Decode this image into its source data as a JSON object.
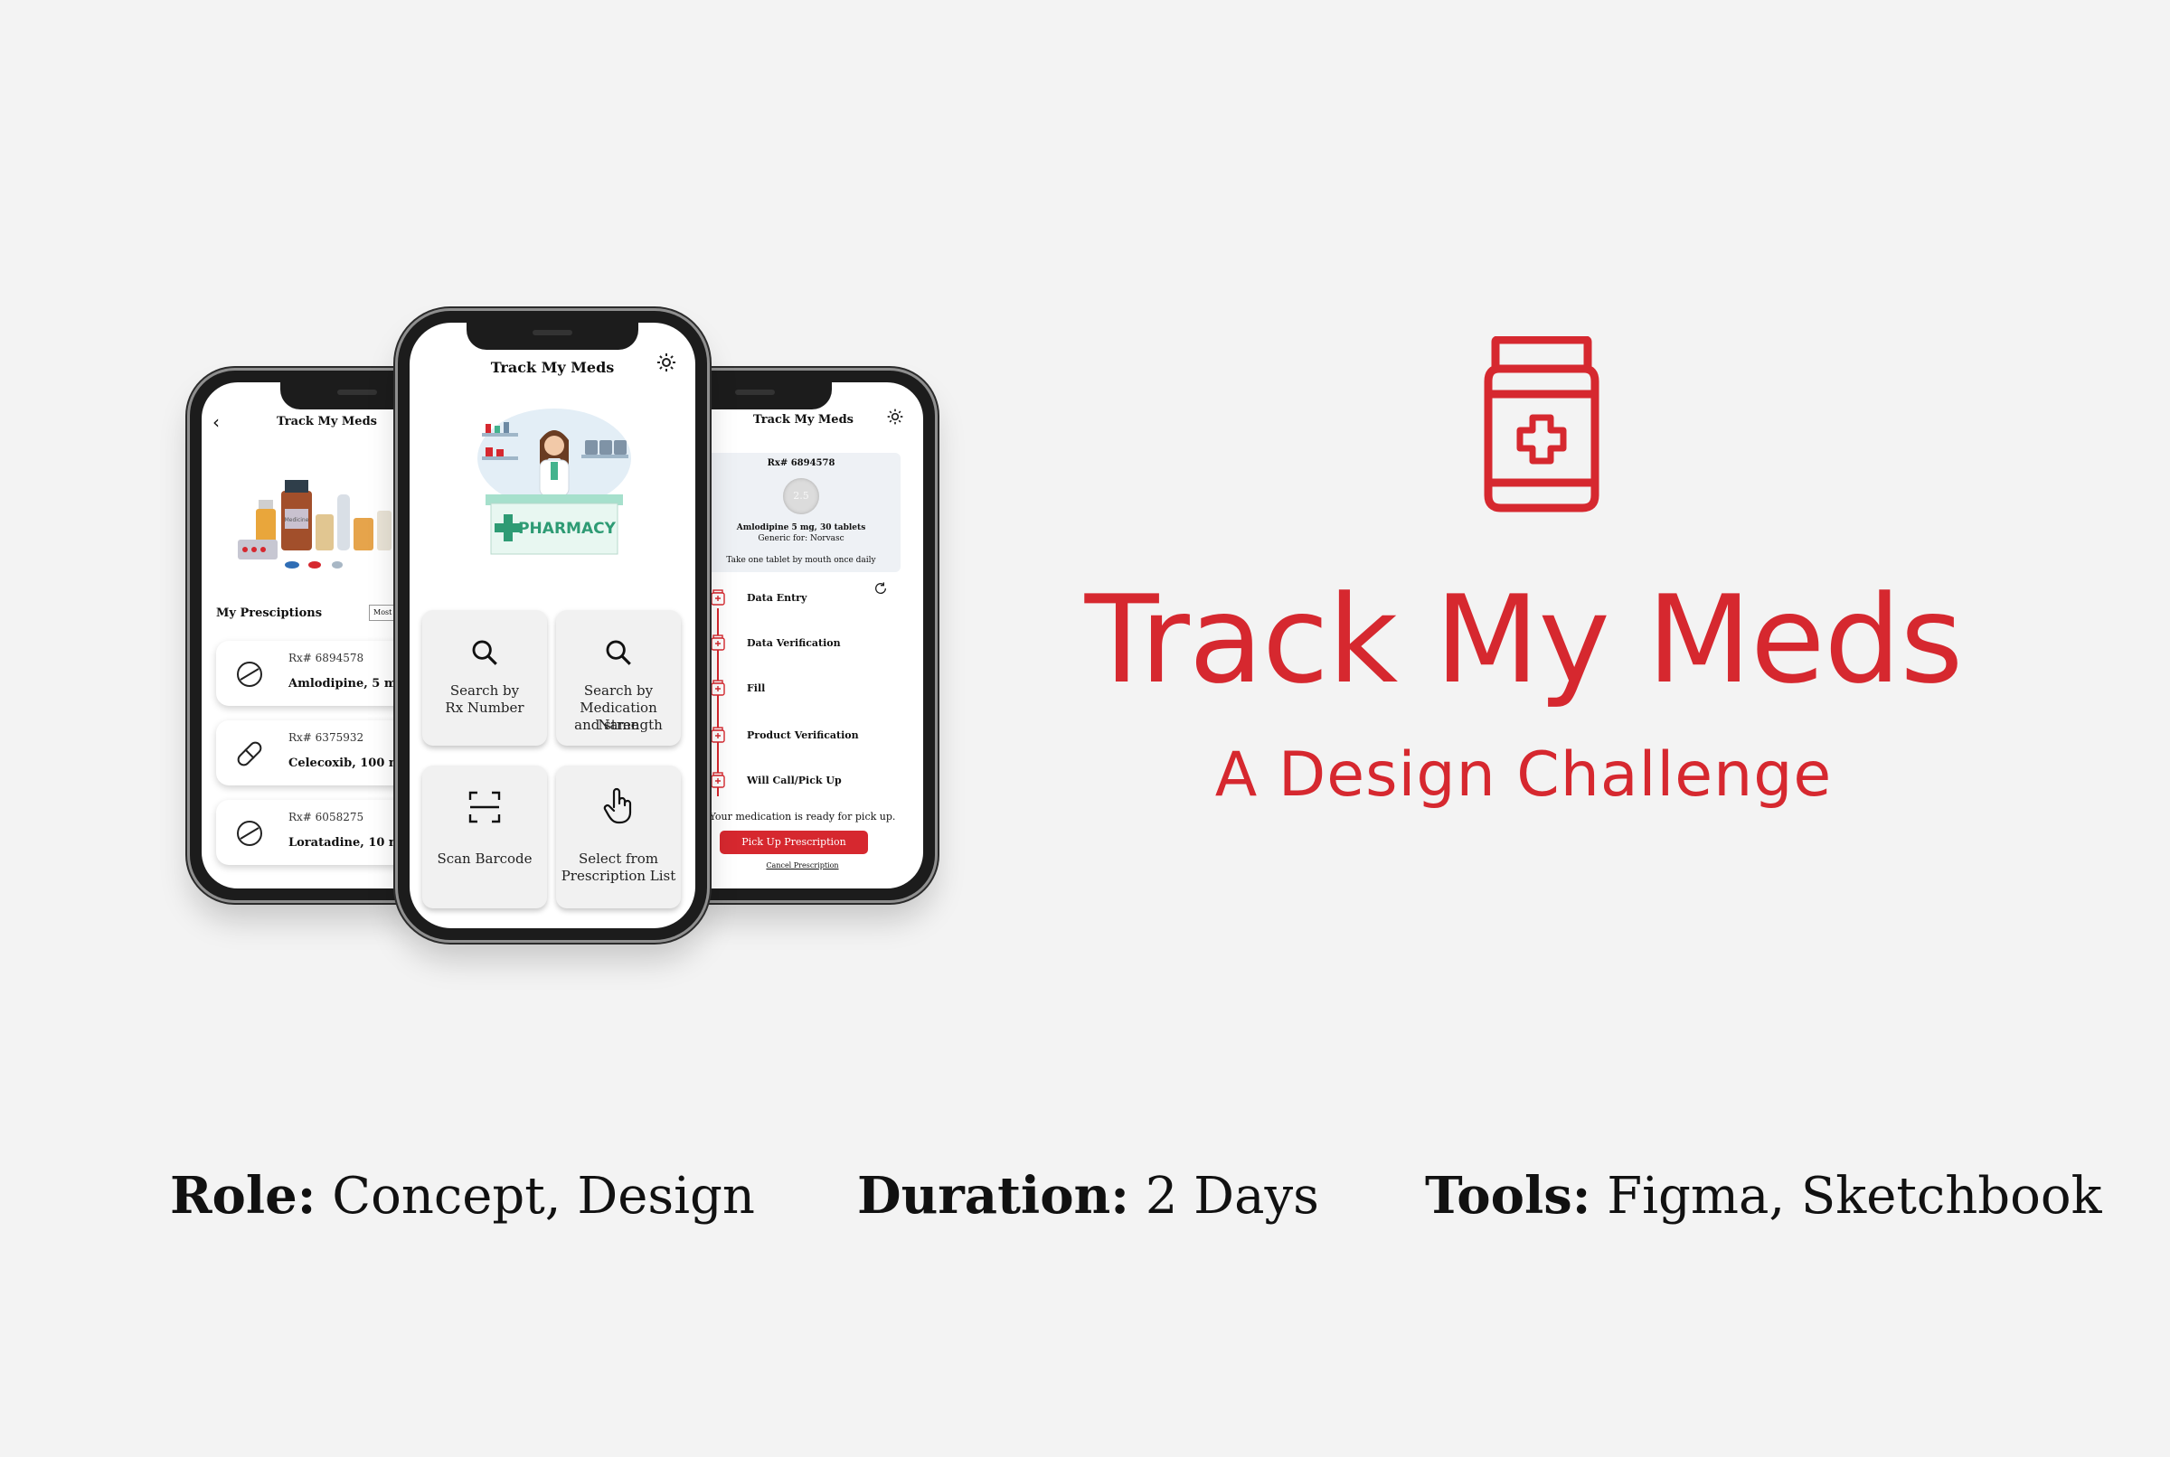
{
  "colors": {
    "accent": "#d6282f",
    "background": "#f3f3f3"
  },
  "left_phone": {
    "title": "Track My Meds",
    "section_label": "My Presciptions",
    "sort_label": "Most Rec",
    "image_label": "Medicine",
    "prescriptions": [
      {
        "rx": "Rx# 6894578",
        "drug": "Amlodipine, 5 mg",
        "icon": "tablet-icon"
      },
      {
        "rx": "Rx# 6375932",
        "drug": "Celecoxib, 100 mg",
        "icon": "capsule-icon"
      },
      {
        "rx": "Rx# 6058275",
        "drug": "Loratadine, 10 mg",
        "icon": "tablet-icon"
      }
    ]
  },
  "center_phone": {
    "title": "Track My Meds",
    "banner_text": "PHARMACY",
    "tiles": [
      {
        "line1": "Search by",
        "line2": "Rx Number",
        "line3": "",
        "icon": "search-icon"
      },
      {
        "line1": "Search by",
        "line2": "Medication Name",
        "line3": "and strength",
        "icon": "search-icon"
      },
      {
        "line1": "Scan Barcode",
        "line2": "",
        "line3": "",
        "icon": "scan-icon"
      },
      {
        "line1": "Select from",
        "line2": "Prescription List",
        "line3": "",
        "icon": "hand-pointer-icon"
      }
    ]
  },
  "right_phone": {
    "title": "Track My Meds",
    "rx": "Rx# 6894578",
    "pill_imprint": "2.5",
    "drug": "Amlodipine 5 mg, 30 tablets",
    "generic": "Generic for: Norvasc",
    "instructions": "Take one tablet by mouth once daily",
    "steps": [
      "Data Entry",
      "Data Verification",
      "Fill",
      "Product Verification",
      "Will Call/Pick Up"
    ],
    "status": "Your medication is ready for pick up.",
    "pickup_button": "Pick Up Prescription",
    "cancel_link": "Cancel Prescription"
  },
  "brand": {
    "title": "Track My Meds",
    "subtitle": "A Design Challenge",
    "icon": "medicine-bottle-icon"
  },
  "meta": {
    "role_label": "Role:",
    "role_value": " Concept, Design",
    "duration_label": "Duration:",
    "duration_value": " 2 Days",
    "tools_label": "Tools:",
    "tools_value": " Figma, Sketchbook"
  }
}
